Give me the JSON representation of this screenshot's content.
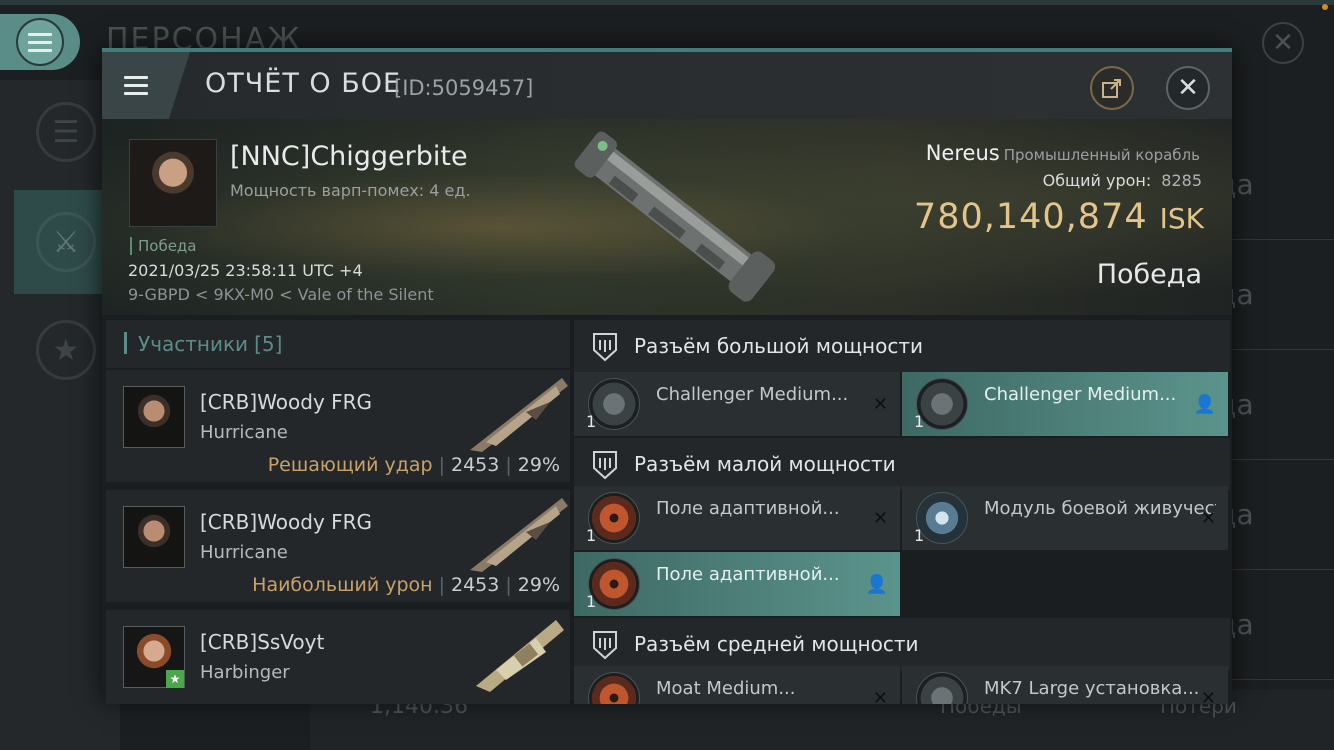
{
  "background": {
    "title": "ПЕРСОНАЖ",
    "right_rows": [
      "ода",
      "ода",
      "ода",
      "ода",
      "ода"
    ],
    "bottom": {
      "value": "1,140.36",
      "wins": "Победы",
      "losses": "Потери"
    }
  },
  "modal": {
    "title": "ОТЧЁТ О БОЕ",
    "report_id": "[ID:5059457]"
  },
  "victim": {
    "name": "[NNC]Chiggerbite",
    "warp": "Мощность варп-помех: 4 ед.",
    "tag": "Победа",
    "datetime": "2021/03/25 23:58:11 UTC +4",
    "location": "9-GBPD < 9KX-M0 < Vale of the Silent",
    "ship": "Nereus",
    "ship_class": "Промышленный корабль",
    "damage_label": "Общий урон:",
    "damage_value": "8285",
    "isk_value": "780,140,874",
    "isk_unit": "ISK",
    "result": "Победа"
  },
  "participants": {
    "label": "Участники",
    "count": "[5]",
    "rows": [
      {
        "name": "[CRB]Woody FRG",
        "ship": "Hurricane",
        "role": "Решающий удар",
        "damage": "2453",
        "percent": "29%"
      },
      {
        "name": "[CRB]Woody FRG",
        "ship": "Hurricane",
        "role": "Наибольший урон",
        "damage": "2453",
        "percent": "29%"
      },
      {
        "name": "[CRB]SsVoyt",
        "ship": "Harbinger",
        "role": "",
        "damage": "",
        "percent": ""
      }
    ]
  },
  "fittings": {
    "high": {
      "title": "Разъём большой мощности",
      "items": [
        {
          "name": "Challenger Medium...",
          "qty": "1",
          "status": "✕"
        },
        {
          "name": "Challenger Medium...",
          "qty": "1",
          "status": "person-icon"
        }
      ]
    },
    "low": {
      "title": "Разъём малой мощности",
      "items": [
        {
          "name": "Поле адаптивной...",
          "qty": "1",
          "status": "✕"
        },
        {
          "name": "Модуль боевой живучести, ...",
          "qty": "1",
          "status": "✕"
        },
        {
          "name": "Поле адаптивной...",
          "qty": "1",
          "status": "person-icon"
        }
      ]
    },
    "mid": {
      "title": "Разъём средней мощности",
      "items": [
        {
          "name": "Moat Medium...",
          "qty": "",
          "status": "✕"
        },
        {
          "name": "MK7 Large установка...",
          "qty": "",
          "status": "✕"
        }
      ]
    }
  },
  "colors": {
    "accent": "#5b948c",
    "isk": "#e3c48a",
    "role": "#c9a16a"
  }
}
